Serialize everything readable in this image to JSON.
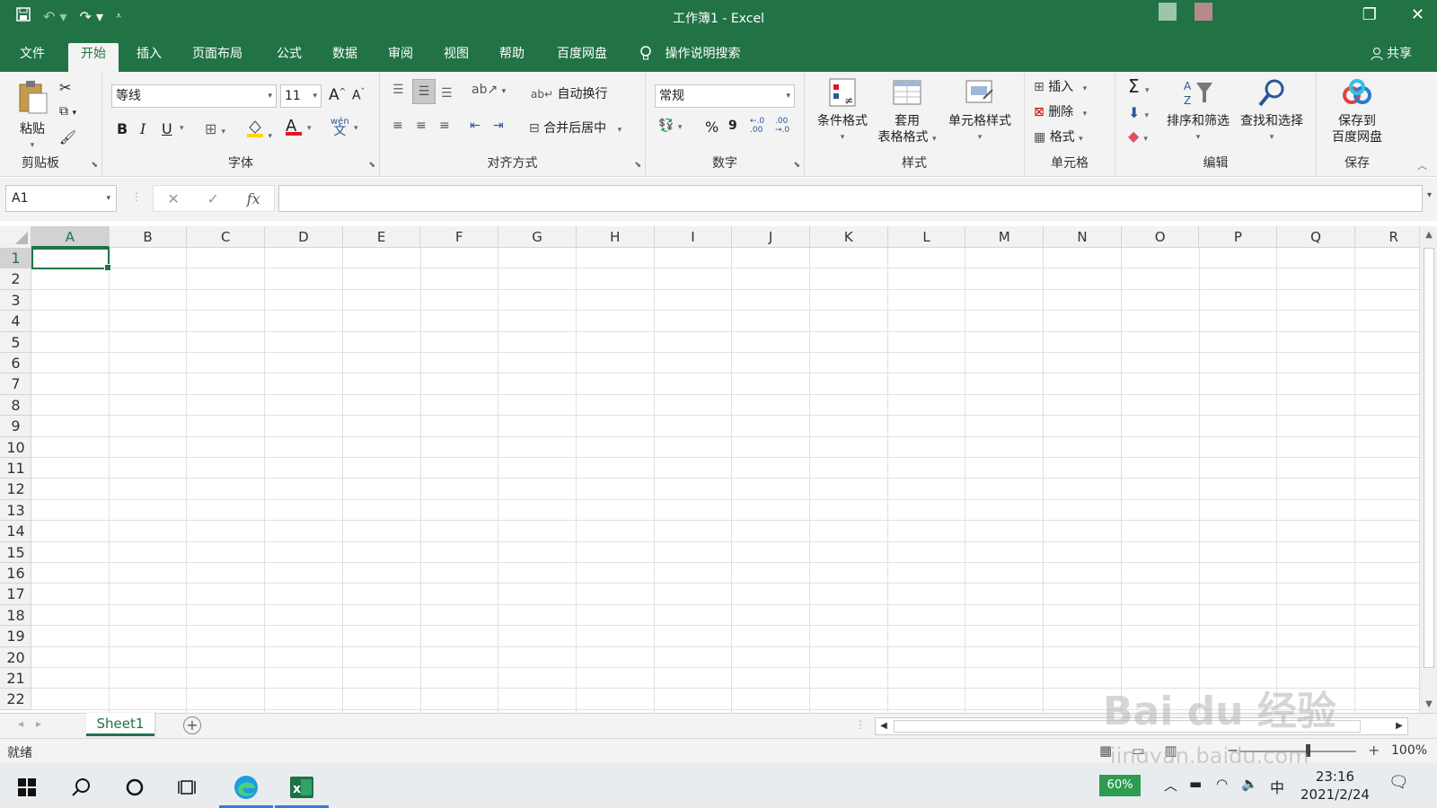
{
  "titlebar": {
    "title": "工作簿1  -  Excel",
    "qat": {
      "save_icon": "save-icon",
      "undo_icon": "undo-icon",
      "redo_icon": "redo-icon",
      "customize_icon": "customize-qat-icon"
    },
    "window_buttons": {
      "restore": "restore-icon",
      "close": "close-icon"
    }
  },
  "tabs": {
    "items": [
      "文件",
      "开始",
      "插入",
      "页面布局",
      "公式",
      "数据",
      "审阅",
      "视图",
      "帮助",
      "百度网盘"
    ],
    "active": "开始",
    "tell_me": "操作说明搜索",
    "share": "共享"
  },
  "ribbon": {
    "clipboard": {
      "label": "剪贴板",
      "paste": "粘贴"
    },
    "font": {
      "label": "字体",
      "font_name": "等线",
      "font_size": "11",
      "bold": "B",
      "italic": "I",
      "underline": "U",
      "grow": "A",
      "shrink": "A",
      "phonetic": "wén",
      "font_color": "#e81123",
      "fill_color": "#ffd400"
    },
    "alignment": {
      "label": "对齐方式",
      "wrap_text": "自动换行",
      "merge_center": "合并后居中"
    },
    "number": {
      "label": "数字",
      "format": "常规",
      "percent": "%",
      "comma": "9",
      "inc_decimal_top": "←.0",
      "inc_decimal_bottom": ".00",
      "dec_decimal_top": ".00",
      "dec_decimal_bottom": "→.0"
    },
    "styles": {
      "label": "样式",
      "conditional": "条件格式",
      "table_top": "套用",
      "table_bottom": "表格格式",
      "cell_styles": "单元格样式"
    },
    "cells": {
      "label": "单元格",
      "insert": "插入",
      "delete": "删除",
      "format": "格式"
    },
    "editing": {
      "label": "编辑",
      "autosum": "Σ",
      "sort_filter": "排序和筛选",
      "find_select": "查找和选择"
    },
    "save": {
      "label": "保存",
      "save_to_top": "保存到",
      "save_to_bottom": "百度网盘"
    }
  },
  "formula_bar": {
    "name_box": "A1",
    "fx": "fx",
    "value": ""
  },
  "grid": {
    "columns": [
      "A",
      "B",
      "C",
      "D",
      "E",
      "F",
      "G",
      "H",
      "I",
      "J",
      "K",
      "L",
      "M",
      "N",
      "O",
      "P",
      "Q",
      "R"
    ],
    "rows": [
      "1",
      "2",
      "3",
      "4",
      "5",
      "6",
      "7",
      "8",
      "9",
      "10",
      "11",
      "12",
      "13",
      "14",
      "15",
      "16",
      "17",
      "18",
      "19",
      "20",
      "21",
      "22"
    ],
    "selected_cell": "A1"
  },
  "sheets": {
    "tabs": [
      "Sheet1"
    ],
    "active": "Sheet1",
    "add": "+"
  },
  "statusbar": {
    "ready": "就绪",
    "zoom": "100%",
    "zoom_minus": "−",
    "zoom_plus": "+"
  },
  "taskbar": {
    "battery": "60%",
    "ime": "中",
    "time": "23:16",
    "date": "2021/2/24",
    "apps": [
      "start-icon",
      "search-icon",
      "cortana-icon",
      "task-view-icon",
      "edge-icon",
      "excel-icon"
    ]
  },
  "watermark": {
    "text": "Bai du 经验",
    "url": "jingyan.baidu.com"
  },
  "colors": {
    "accent": "#217346",
    "ribbon_bg": "#f3f3f3",
    "grid_line": "#e1e1e1"
  }
}
